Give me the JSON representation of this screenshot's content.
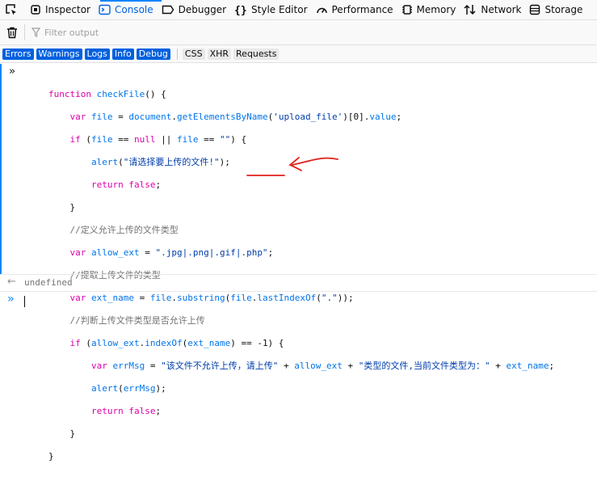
{
  "toolbar": {
    "tabs": [
      {
        "label": "Inspector",
        "icon": "inspector-icon"
      },
      {
        "label": "Console",
        "icon": "console-icon",
        "selected": true
      },
      {
        "label": "Debugger",
        "icon": "debugger-icon"
      },
      {
        "label": "Style Editor",
        "icon": "style-editor-icon"
      },
      {
        "label": "Performance",
        "icon": "performance-icon"
      },
      {
        "label": "Memory",
        "icon": "memory-icon"
      },
      {
        "label": "Network",
        "icon": "network-icon"
      },
      {
        "label": "Storage",
        "icon": "storage-icon"
      }
    ]
  },
  "filterbar": {
    "placeholder": "Filter output"
  },
  "chips": {
    "log_levels": [
      {
        "label": "Errors",
        "active": true
      },
      {
        "label": "Warnings",
        "active": true
      },
      {
        "label": "Logs",
        "active": true
      },
      {
        "label": "Info",
        "active": true
      },
      {
        "label": "Debug",
        "active": true
      }
    ],
    "request_types": [
      {
        "label": "CSS",
        "active": false
      },
      {
        "label": "XHR",
        "active": false
      },
      {
        "label": "Requests",
        "active": false
      }
    ]
  },
  "console": {
    "code_lines": [
      "function checkFile() {",
      "    var file = document.getElementsByName('upload_file')[0].value;",
      "    if (file == null || file == \"\") {",
      "        alert(\"请选择要上传的文件!\");",
      "        return false;",
      "    }",
      "    //定义允许上传的文件类型",
      "    var allow_ext = \".jpg|.png|.gif|.php\";",
      "    //提取上传文件的类型",
      "    var ext_name = file.substring(file.lastIndexOf(\".\"));",
      "    //判断上传文件类型是否允许上传",
      "    if (allow_ext.indexOf(ext_name) == -1) {",
      "        var errMsg = \"该文件不允许上传，请上传\" + allow_ext + \"类型的文件,当前文件类型为：\" + ext_name;",
      "        alert(errMsg);",
      "        return false;",
      "    }",
      "}"
    ],
    "result": "undefined"
  },
  "colors": {
    "accent": "#0a84ff",
    "selected_tab": "#0060df",
    "keyword": "#dd00a9",
    "identifier": "#0074e8",
    "string": "#003eaa",
    "comment": "#737373",
    "annotation": "#e0201a"
  }
}
